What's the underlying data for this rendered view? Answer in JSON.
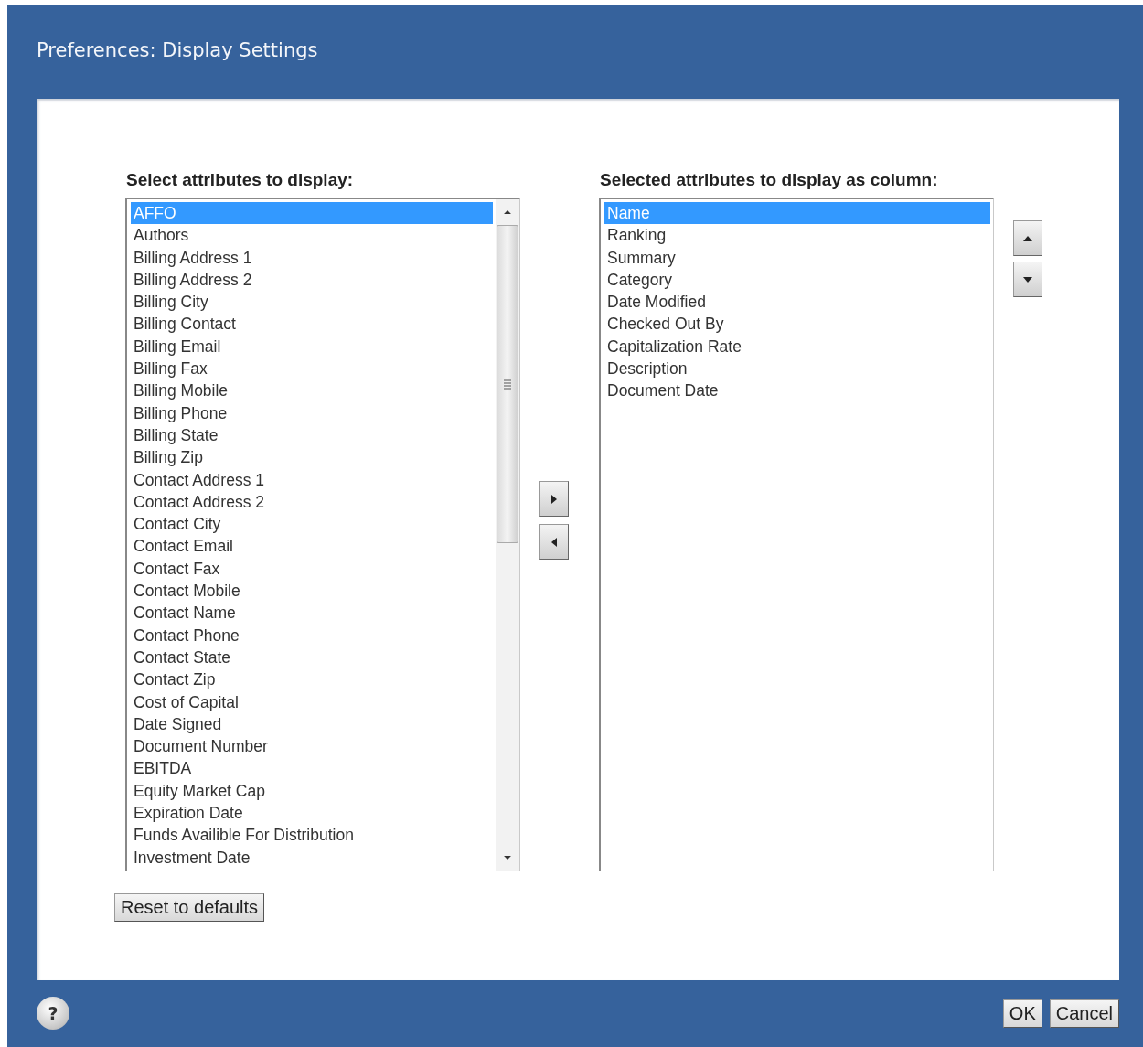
{
  "window": {
    "title": "Preferences: Display Settings"
  },
  "available": {
    "label": "Select attributes to display:",
    "items": [
      {
        "text": "AFFO",
        "selected": true
      },
      {
        "text": "Authors",
        "selected": false
      },
      {
        "text": "Billing Address 1",
        "selected": false
      },
      {
        "text": "Billing Address 2",
        "selected": false
      },
      {
        "text": "Billing City",
        "selected": false
      },
      {
        "text": "Billing Contact",
        "selected": false
      },
      {
        "text": "Billing Email",
        "selected": false
      },
      {
        "text": "Billing Fax",
        "selected": false
      },
      {
        "text": "Billing Mobile",
        "selected": false
      },
      {
        "text": "Billing Phone",
        "selected": false
      },
      {
        "text": "Billing State",
        "selected": false
      },
      {
        "text": "Billing Zip",
        "selected": false
      },
      {
        "text": "Contact Address 1",
        "selected": false
      },
      {
        "text": "Contact Address 2",
        "selected": false
      },
      {
        "text": "Contact City",
        "selected": false
      },
      {
        "text": "Contact Email",
        "selected": false
      },
      {
        "text": "Contact Fax",
        "selected": false
      },
      {
        "text": "Contact Mobile",
        "selected": false
      },
      {
        "text": "Contact Name",
        "selected": false
      },
      {
        "text": "Contact Phone",
        "selected": false
      },
      {
        "text": "Contact State",
        "selected": false
      },
      {
        "text": "Contact Zip",
        "selected": false
      },
      {
        "text": "Cost of Capital",
        "selected": false
      },
      {
        "text": "Date Signed",
        "selected": false
      },
      {
        "text": "Document Number",
        "selected": false
      },
      {
        "text": "EBITDA",
        "selected": false
      },
      {
        "text": "Equity Market Cap",
        "selected": false
      },
      {
        "text": "Expiration Date",
        "selected": false
      },
      {
        "text": "Funds Availible For Distribution",
        "selected": false
      },
      {
        "text": "Investment Date",
        "selected": false
      }
    ]
  },
  "selected_columns": {
    "label": "Selected attributes to display as column:",
    "items": [
      {
        "text": "Name",
        "selected": true
      },
      {
        "text": "Ranking",
        "selected": false
      },
      {
        "text": "Summary",
        "selected": false
      },
      {
        "text": "Category",
        "selected": false
      },
      {
        "text": "Date Modified",
        "selected": false
      },
      {
        "text": "Checked Out By",
        "selected": false
      },
      {
        "text": "Capitalization Rate",
        "selected": false
      },
      {
        "text": "Description",
        "selected": false
      },
      {
        "text": "Document Date",
        "selected": false
      }
    ]
  },
  "reset_button": "Reset to defaults",
  "help_button": "?",
  "buttons": [
    "OK",
    "Cancel"
  ]
}
